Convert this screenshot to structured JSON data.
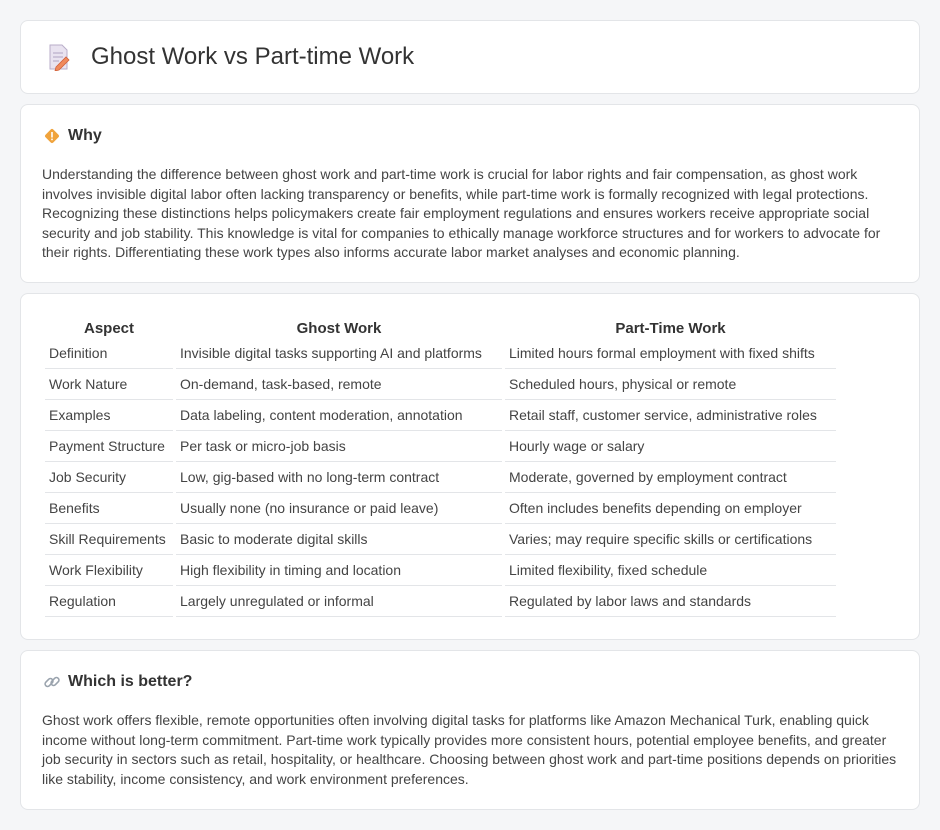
{
  "header": {
    "title": "Ghost Work vs Part-time Work",
    "icon": "document-pencil-icon"
  },
  "why": {
    "icon": "diamond-warning-icon",
    "title": "Why",
    "text": "Understanding the difference between ghost work and part-time work is crucial for labor rights and fair compensation, as ghost work involves invisible digital labor often lacking transparency or benefits, while part-time work is formally recognized with legal protections. Recognizing these distinctions helps policymakers create fair employment regulations and ensures workers receive appropriate social security and job stability. This knowledge is vital for companies to ethically manage workforce structures and for workers to advocate for their rights. Differentiating these work types also informs accurate labor market analyses and economic planning."
  },
  "table": {
    "headers": [
      "Aspect",
      "Ghost Work",
      "Part-Time Work"
    ],
    "rows": [
      [
        "Definition",
        "Invisible digital tasks supporting AI and platforms",
        "Limited hours formal employment with fixed shifts"
      ],
      [
        "Work Nature",
        "On-demand, task-based, remote",
        "Scheduled hours, physical or remote"
      ],
      [
        "Examples",
        "Data labeling, content moderation, annotation",
        "Retail staff, customer service, administrative roles"
      ],
      [
        "Payment Structure",
        "Per task or micro-job basis",
        "Hourly wage or salary"
      ],
      [
        "Job Security",
        "Low, gig-based with no long-term contract",
        "Moderate, governed by employment contract"
      ],
      [
        "Benefits",
        "Usually none (no insurance or paid leave)",
        "Often includes benefits depending on employer"
      ],
      [
        "Skill Requirements",
        "Basic to moderate digital skills",
        "Varies; may require specific skills or certifications"
      ],
      [
        "Work Flexibility",
        "High flexibility in timing and location",
        "Limited flexibility, fixed schedule"
      ],
      [
        "Regulation",
        "Largely unregulated or informal",
        "Regulated by labor laws and standards"
      ]
    ]
  },
  "better": {
    "icon": "link-icon",
    "title": "Which is better?",
    "text": "Ghost work offers flexible, remote opportunities often involving digital tasks for platforms like Amazon Mechanical Turk, enabling quick income without long-term commitment. Part-time work typically provides more consistent hours, potential employee benefits, and greater job security in sectors such as retail, hospitality, or healthcare. Choosing between ghost work and part-time positions depends on priorities like stability, income consistency, and work environment preferences."
  },
  "colors": {
    "background": "#f5f6f8",
    "card": "#ffffff",
    "border": "#e3e5e8",
    "icon_accent": "#f0a33c"
  }
}
